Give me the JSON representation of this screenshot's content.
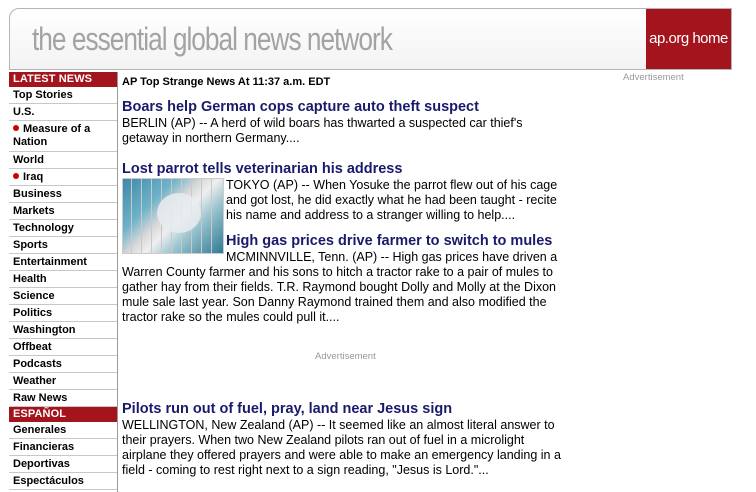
{
  "header": {
    "tagline": "the essential global news network",
    "home_label": "ap.org home"
  },
  "sidebar": {
    "latest_heading": "LATEST NEWS",
    "latest_items": [
      {
        "label": "Top Stories",
        "dot": false
      },
      {
        "label": "U.S.",
        "dot": false
      },
      {
        "label": "Measure of a Nation",
        "dot": true
      },
      {
        "label": "World",
        "dot": false
      },
      {
        "label": "Iraq",
        "dot": true
      },
      {
        "label": "Business",
        "dot": false
      },
      {
        "label": "Markets",
        "dot": false
      },
      {
        "label": "Technology",
        "dot": false
      },
      {
        "label": "Sports",
        "dot": false
      },
      {
        "label": "Entertainment",
        "dot": false
      },
      {
        "label": "Health",
        "dot": false
      },
      {
        "label": "Science",
        "dot": false
      },
      {
        "label": "Politics",
        "dot": false
      },
      {
        "label": "Washington",
        "dot": false
      },
      {
        "label": "Offbeat",
        "dot": false
      },
      {
        "label": "Podcasts",
        "dot": false
      },
      {
        "label": "Weather",
        "dot": false
      },
      {
        "label": "Raw News",
        "dot": false
      }
    ],
    "espanol_heading": "ESPAÑOL",
    "espanol_items": [
      {
        "label": "Generales"
      },
      {
        "label": "Financieras"
      },
      {
        "label": "Deportivas"
      },
      {
        "label": "Espectáculos"
      }
    ]
  },
  "main": {
    "section_title": "AP Top Strange News At 11:37 a.m. EDT",
    "stories": [
      {
        "headline": "Boars help German cops capture auto theft suspect",
        "summary": "BERLIN (AP) -- A herd of wild boars has thwarted a suspected car thief's getaway in northern Germany...."
      },
      {
        "headline": "Lost parrot tells veterinarian his address",
        "summary": "TOKYO (AP) -- When Yosuke the parrot flew out of his cage and got lost, he did exactly what he had been taught - recite his name and address to a stranger willing to help...."
      },
      {
        "headline": "High gas prices drive farmer to switch to mules",
        "summary": "MCMINNVILLE, Tenn. (AP) -- High gas prices have driven a Warren County farmer and his sons to hitch a tractor rake to a pair of mules to gather hay from their fields. T.R. Raymond bought Dolly and Molly at the Dixon mule sale last year. Son Danny Raymond trained them and also modified the tractor rake so the mules could pull it...."
      },
      {
        "headline": "Pilots run out of fuel, pray, land near Jesus sign",
        "summary": "WELLINGTON, New Zealand (AP) -- It seemed like an almost literal answer to their prayers. When two New Zealand pilots ran out of fuel in a microlight airplane they offered prayers and were able to make an emergency landing in a field - coming to rest right next to a sign reading, \"Jesus is Lord.\"..."
      }
    ],
    "advertisement_label": "Advertisement"
  },
  "right_column": {
    "advertisement_label": "Advertisement"
  }
}
